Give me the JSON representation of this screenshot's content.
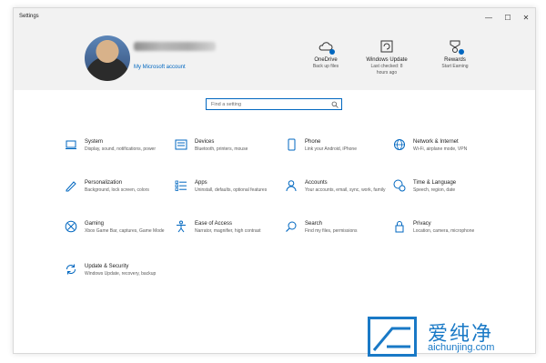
{
  "window": {
    "title": "Settings",
    "minimize": "—",
    "maximize": "☐",
    "close": "✕"
  },
  "header": {
    "account_link": "My Microsoft account",
    "items": [
      {
        "title": "OneDrive",
        "sub": "Back up files",
        "icon": "onedrive-icon"
      },
      {
        "title": "Windows Update",
        "sub": "Last checked: 8 hours ago",
        "icon": "windows-update-icon"
      },
      {
        "title": "Rewards",
        "sub": "Start Earning",
        "icon": "rewards-icon"
      }
    ]
  },
  "search": {
    "placeholder": "Find a setting"
  },
  "categories": [
    {
      "title": "System",
      "desc": "Display, sound, notifications, power",
      "icon": "laptop-icon"
    },
    {
      "title": "Devices",
      "desc": "Bluetooth, printers, mouse",
      "icon": "keyboard-icon"
    },
    {
      "title": "Phone",
      "desc": "Link your Android, iPhone",
      "icon": "phone-icon"
    },
    {
      "title": "Network & Internet",
      "desc": "Wi-Fi, airplane mode, VPN",
      "icon": "globe-icon"
    },
    {
      "title": "Personalization",
      "desc": "Background, lock screen, colors",
      "icon": "pen-icon"
    },
    {
      "title": "Apps",
      "desc": "Uninstall, defaults, optional features",
      "icon": "apps-list-icon"
    },
    {
      "title": "Accounts",
      "desc": "Your accounts, email, sync, work, family",
      "icon": "person-icon"
    },
    {
      "title": "Time & Language",
      "desc": "Speech, region, date",
      "icon": "time-language-icon"
    },
    {
      "title": "Gaming",
      "desc": "Xbox Game Bar, captures, Game Mode",
      "icon": "xbox-icon"
    },
    {
      "title": "Ease of Access",
      "desc": "Narrator, magnifier, high contrast",
      "icon": "accessibility-icon"
    },
    {
      "title": "Search",
      "desc": "Find my files, permissions",
      "icon": "search-icon"
    },
    {
      "title": "Privacy",
      "desc": "Location, camera, microphone",
      "icon": "lock-icon"
    },
    {
      "title": "Update & Security",
      "desc": "Windows Update, recovery, backup",
      "icon": "sync-icon"
    }
  ],
  "watermark": {
    "cn": "爱纯净",
    "en": "aichunjing.com"
  },
  "colors": {
    "accent": "#0067c0",
    "watermark": "#1979c6",
    "header_bg": "#f2f2f2"
  }
}
